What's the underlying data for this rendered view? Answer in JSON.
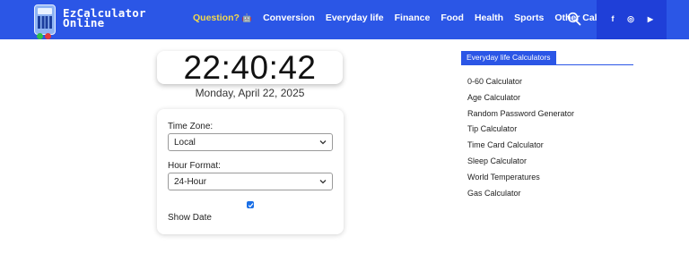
{
  "brand": {
    "line1": "EzCalculator",
    "line2": "Online"
  },
  "nav": {
    "question": "Question?",
    "question_emoji": "🤖",
    "items": [
      "Conversion",
      "Everyday life",
      "Finance",
      "Food",
      "Health",
      "Sports",
      "Other Calculator"
    ]
  },
  "social": {
    "facebook": "f",
    "instagram": "◎",
    "youtube": "▶"
  },
  "clock": {
    "time": "22:40:42",
    "date": "Monday, April 22, 2025"
  },
  "settings": {
    "timezone_label": "Time Zone:",
    "timezone_value": "Local",
    "format_label": "Hour Format:",
    "format_value": "24-Hour",
    "show_date_checked": true,
    "show_date_label": "Show Date"
  },
  "sidebar": {
    "title": "Everyday life Calculators",
    "items": [
      "0-60 Calculator",
      "Age Calculator",
      "Random Password Generator",
      "Tip Calculator",
      "Time Card Calculator",
      "Sleep Calculator",
      "World Temperatures",
      "Gas Calculator"
    ]
  },
  "colors": {
    "header": "#2b56e6",
    "social_bg": "#1f3fd8",
    "question": "#f3d84b",
    "checkbox": "#1a6fe6"
  }
}
